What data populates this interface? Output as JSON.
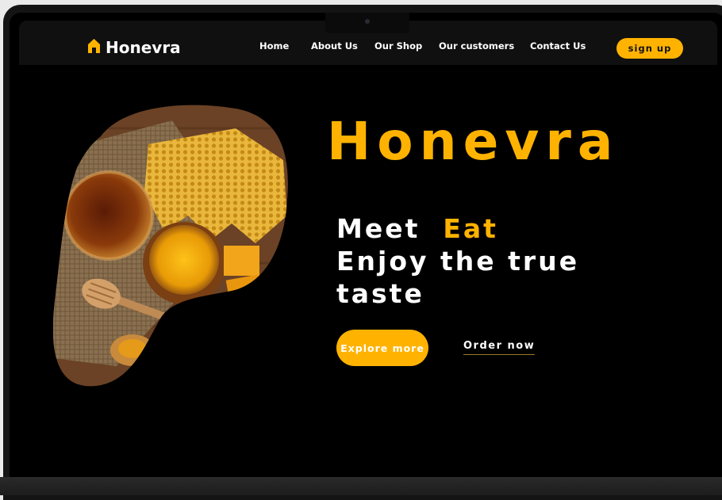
{
  "brand": {
    "name": "Honevra",
    "icon": "home-icon",
    "accent_color": "#ffb300"
  },
  "nav": {
    "items": [
      {
        "label": "Home"
      },
      {
        "label": "About Us"
      },
      {
        "label": "Our Shop"
      },
      {
        "label": "Our customers"
      },
      {
        "label": "Contact Us"
      }
    ],
    "signup_label": "sign up"
  },
  "hero": {
    "title": "Honevra",
    "tagline_word1": "Meet",
    "tagline_accent": "Eat",
    "tagline_line2": "Enjoy the true",
    "tagline_line3": "taste",
    "explore_label": "Explore more",
    "order_label": "Order now",
    "image_subject": "honeycomb-honey-jar-dipper-photo"
  },
  "colors": {
    "background": "#000000",
    "navbar": "#101010",
    "accent": "#ffb300",
    "text": "#ffffff"
  }
}
